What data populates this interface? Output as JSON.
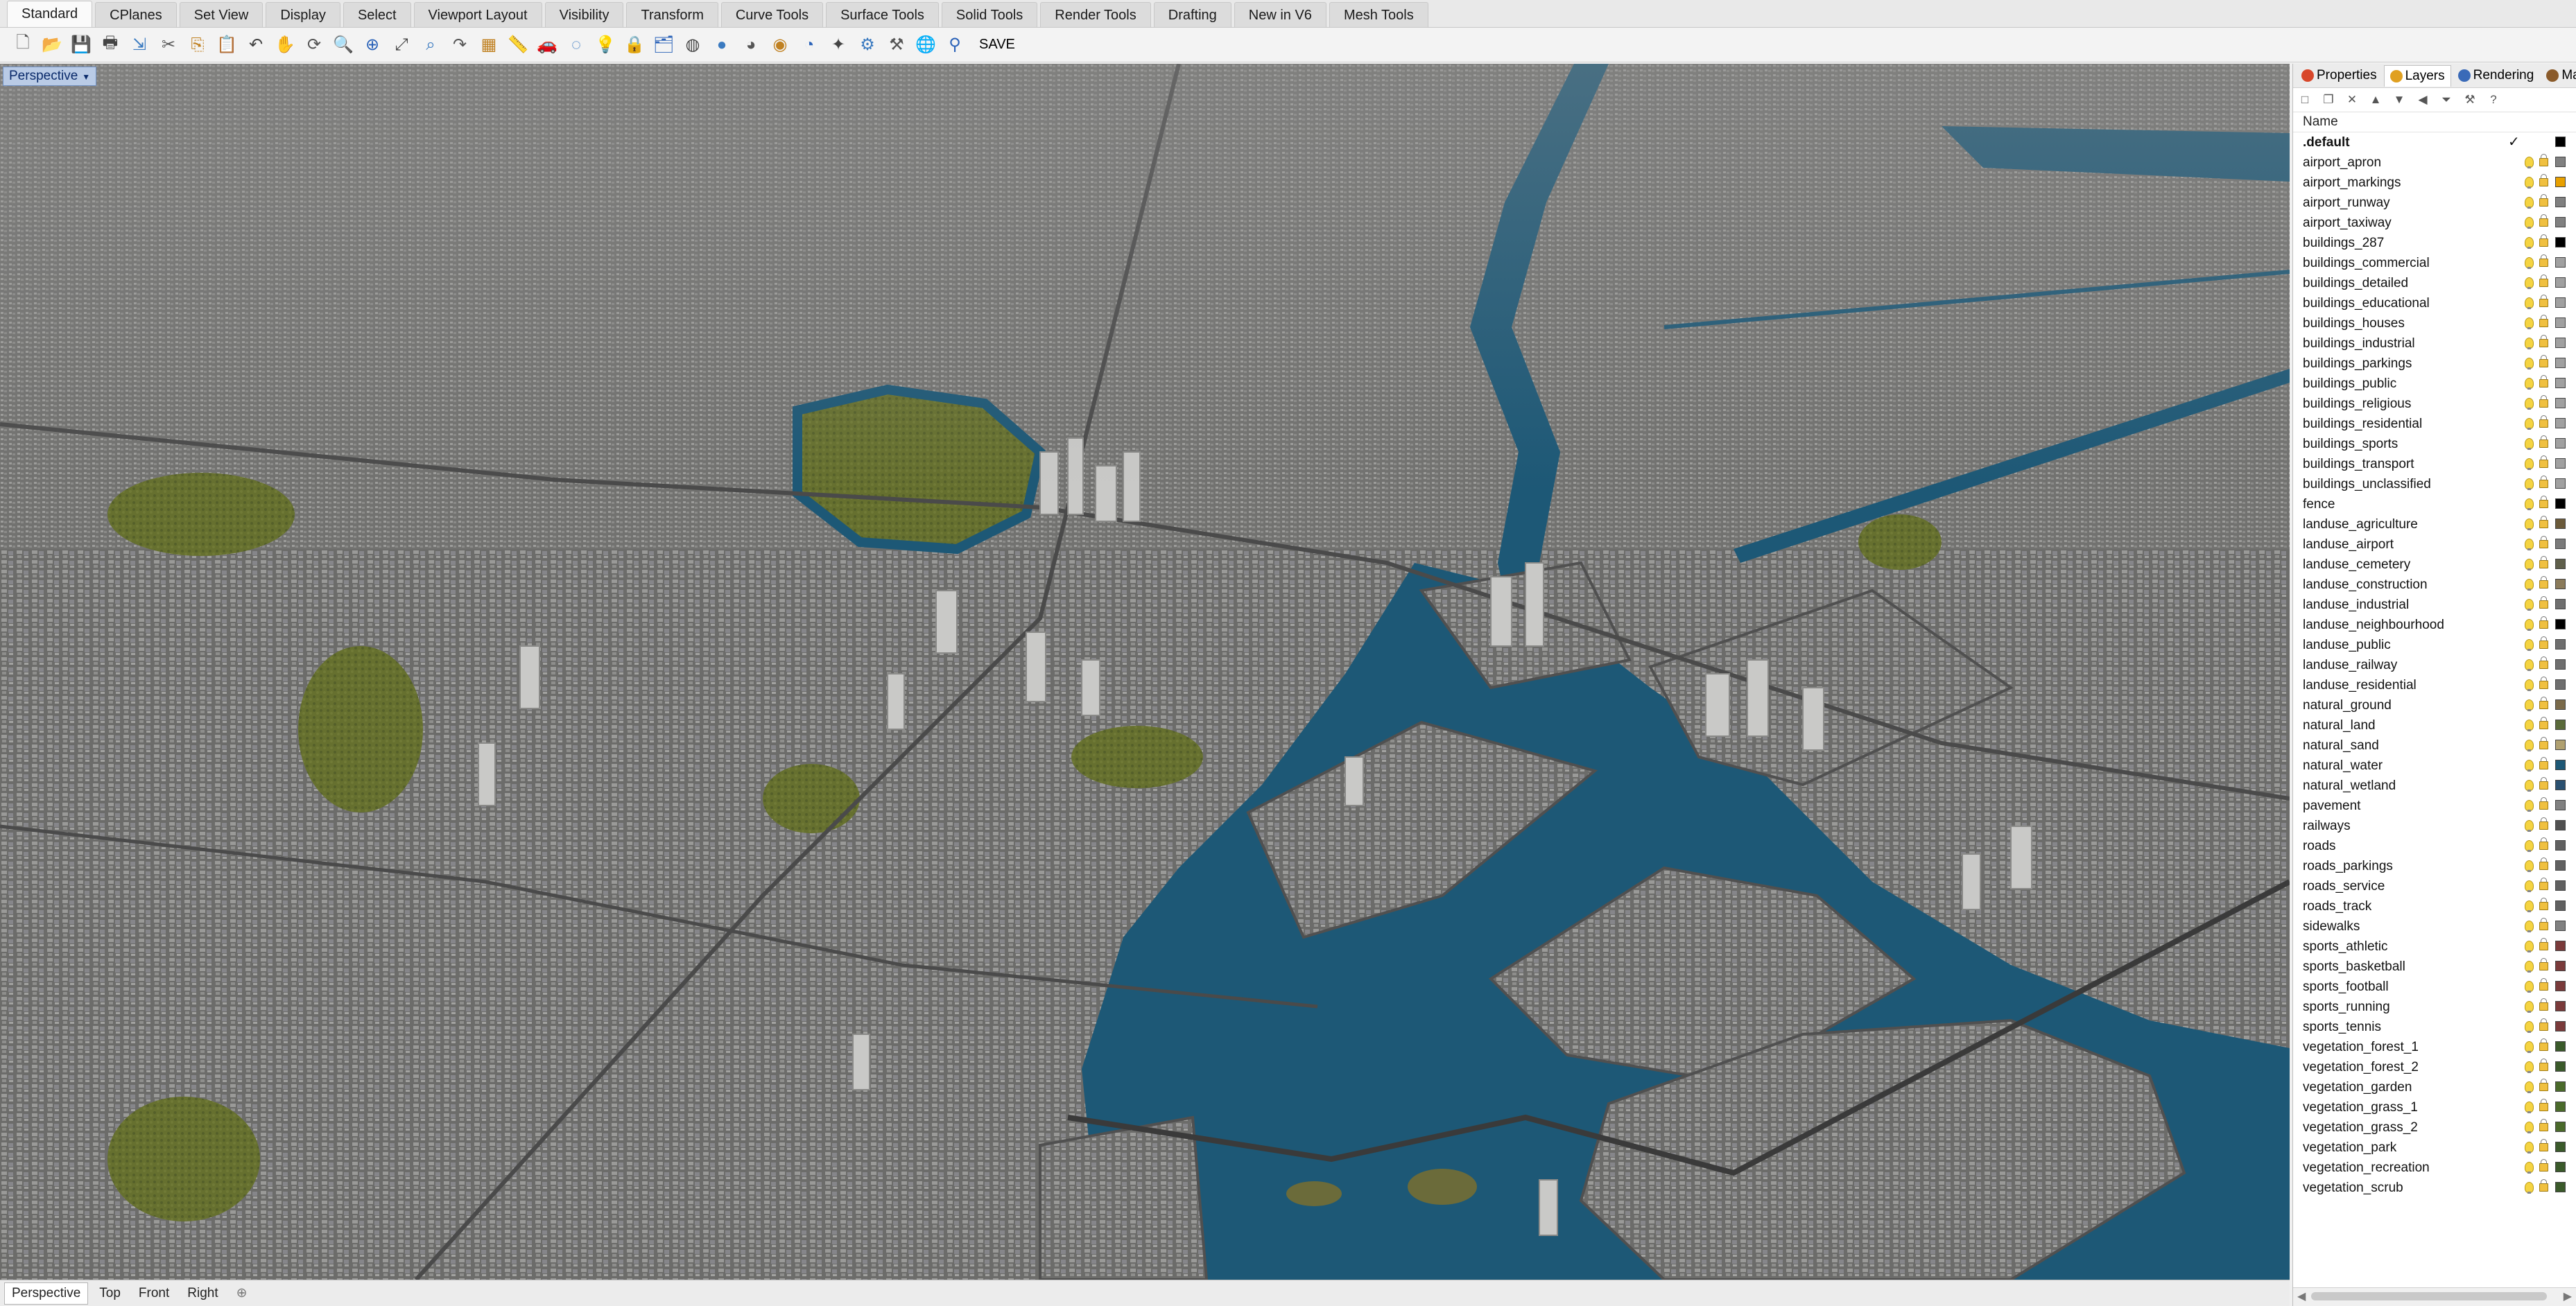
{
  "menu_tabs": [
    "Standard",
    "CPlanes",
    "Set View",
    "Display",
    "Select",
    "Viewport Layout",
    "Visibility",
    "Transform",
    "Curve Tools",
    "Surface Tools",
    "Solid Tools",
    "Render Tools",
    "Drafting",
    "New in V6",
    "Mesh Tools"
  ],
  "active_menu_tab": "Standard",
  "toolbar": {
    "icons": [
      "new-file-icon",
      "open-file-icon",
      "save-icon",
      "print-icon",
      "import-icon",
      "cut-icon",
      "copy-icon",
      "paste-icon",
      "undo-icon",
      "pan-icon",
      "rotate-view-icon",
      "zoom-icon",
      "zoom-window-icon",
      "zoom-extents-icon",
      "zoom-selected-icon",
      "redo-view-icon",
      "grid-icon",
      "tape-measure-icon",
      "car-icon",
      "lasso-icon",
      "lightbulb-icon",
      "lock-icon",
      "layer-icon",
      "color-wheel-icon",
      "shade-sphere-icon",
      "rendered-sphere-icon",
      "material-sphere-icon",
      "render-icon",
      "light-icon",
      "settings-gear-icon",
      "options-icon",
      "globe-icon",
      "help-person-icon"
    ],
    "save_label": "SAVE"
  },
  "viewport": {
    "label": "Perspective",
    "scene_colors": {
      "water": "#1d5876",
      "land": "#6a6a68",
      "park": "#66702f",
      "buildings": "#c4c4c2"
    }
  },
  "bottom_tabs": [
    "Perspective",
    "Top",
    "Front",
    "Right"
  ],
  "active_bottom_tab": "Perspective",
  "panel": {
    "tabs": [
      {
        "label": "Properties",
        "icon": "properties-icon"
      },
      {
        "label": "Layers",
        "icon": "layers-icon"
      },
      {
        "label": "Rendering",
        "icon": "rendering-icon"
      },
      {
        "label": "Mate",
        "icon": "materials-icon"
      }
    ],
    "active_tab": "Layers",
    "column_header": "Name",
    "layers": [
      {
        "name": ".default",
        "color": "#000000",
        "current": true
      },
      {
        "name": "airport_apron",
        "color": "#808080"
      },
      {
        "name": "airport_markings",
        "color": "#e8a000"
      },
      {
        "name": "airport_runway",
        "color": "#808080"
      },
      {
        "name": "airport_taxiway",
        "color": "#808080"
      },
      {
        "name": "buildings_287",
        "color": "#000000"
      },
      {
        "name": "buildings_commercial",
        "color": "#a0a0a0"
      },
      {
        "name": "buildings_detailed",
        "color": "#a0a0a0"
      },
      {
        "name": "buildings_educational",
        "color": "#a0a0a0"
      },
      {
        "name": "buildings_houses",
        "color": "#a0a0a0"
      },
      {
        "name": "buildings_industrial",
        "color": "#a0a0a0"
      },
      {
        "name": "buildings_parkings",
        "color": "#a0a0a0"
      },
      {
        "name": "buildings_public",
        "color": "#a0a0a0"
      },
      {
        "name": "buildings_religious",
        "color": "#a0a0a0"
      },
      {
        "name": "buildings_residential",
        "color": "#a0a0a0"
      },
      {
        "name": "buildings_sports",
        "color": "#a0a0a0"
      },
      {
        "name": "buildings_transport",
        "color": "#a0a0a0"
      },
      {
        "name": "buildings_unclassified",
        "color": "#a0a0a0"
      },
      {
        "name": "fence",
        "color": "#000000"
      },
      {
        "name": "landuse_agriculture",
        "color": "#6b5a3a"
      },
      {
        "name": "landuse_airport",
        "color": "#7a7a7a"
      },
      {
        "name": "landuse_cemetery",
        "color": "#5e5e4a"
      },
      {
        "name": "landuse_construction",
        "color": "#8a7a5a"
      },
      {
        "name": "landuse_industrial",
        "color": "#6e6e6e"
      },
      {
        "name": "landuse_neighbourhood",
        "color": "#000000"
      },
      {
        "name": "landuse_public",
        "color": "#6e6e6e"
      },
      {
        "name": "landuse_railway",
        "color": "#6e6e6e"
      },
      {
        "name": "landuse_residential",
        "color": "#6e6e6e"
      },
      {
        "name": "natural_ground",
        "color": "#7a6a4a"
      },
      {
        "name": "natural_land",
        "color": "#5a6a3a"
      },
      {
        "name": "natural_sand",
        "color": "#b0a070"
      },
      {
        "name": "natural_water",
        "color": "#1d5876"
      },
      {
        "name": "natural_wetland",
        "color": "#2a5070"
      },
      {
        "name": "pavement",
        "color": "#808080"
      },
      {
        "name": "railways",
        "color": "#505050"
      },
      {
        "name": "roads",
        "color": "#606060"
      },
      {
        "name": "roads_parkings",
        "color": "#606060"
      },
      {
        "name": "roads_service",
        "color": "#606060"
      },
      {
        "name": "roads_track",
        "color": "#606060"
      },
      {
        "name": "sidewalks",
        "color": "#808080"
      },
      {
        "name": "sports_athletic",
        "color": "#7a3a3a"
      },
      {
        "name": "sports_basketball",
        "color": "#7a3a3a"
      },
      {
        "name": "sports_football",
        "color": "#7a3a3a"
      },
      {
        "name": "sports_running",
        "color": "#7a3a3a"
      },
      {
        "name": "sports_tennis",
        "color": "#7a3a3a"
      },
      {
        "name": "vegetation_forest_1",
        "color": "#3a5a2a"
      },
      {
        "name": "vegetation_forest_2",
        "color": "#3a5a2a"
      },
      {
        "name": "vegetation_garden",
        "color": "#4a6a2a"
      },
      {
        "name": "vegetation_grass_1",
        "color": "#4a6a2a"
      },
      {
        "name": "vegetation_grass_2",
        "color": "#4a6a2a"
      },
      {
        "name": "vegetation_park",
        "color": "#3a5a2a"
      },
      {
        "name": "vegetation_recreation",
        "color": "#3a5a2a"
      },
      {
        "name": "vegetation_scrub",
        "color": "#3a5a2a"
      }
    ]
  }
}
